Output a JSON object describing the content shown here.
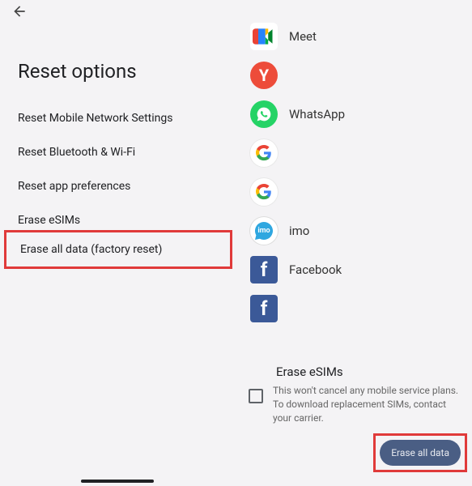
{
  "page_title": "Reset options",
  "options": [
    "Reset Mobile Network Settings",
    "Reset Bluetooth & Wi-Fi",
    "Reset app preferences",
    "Erase eSIMs"
  ],
  "highlighted_option": "Erase all data (factory reset)",
  "apps": [
    {
      "name": "Meet"
    },
    {
      "name": ""
    },
    {
      "name": "WhatsApp"
    },
    {
      "name": ""
    },
    {
      "name": ""
    },
    {
      "name": "imo"
    },
    {
      "name": "Facebook"
    },
    {
      "name": ""
    }
  ],
  "footer": {
    "title": "Erase eSIMs",
    "text": "This won't cancel any mobile service plans. To download replacement SIMs, contact your carrier."
  },
  "erase_button": "Erase all data",
  "icon_letters": {
    "yandex": "Y",
    "facebook": "f",
    "imo": "imo"
  }
}
